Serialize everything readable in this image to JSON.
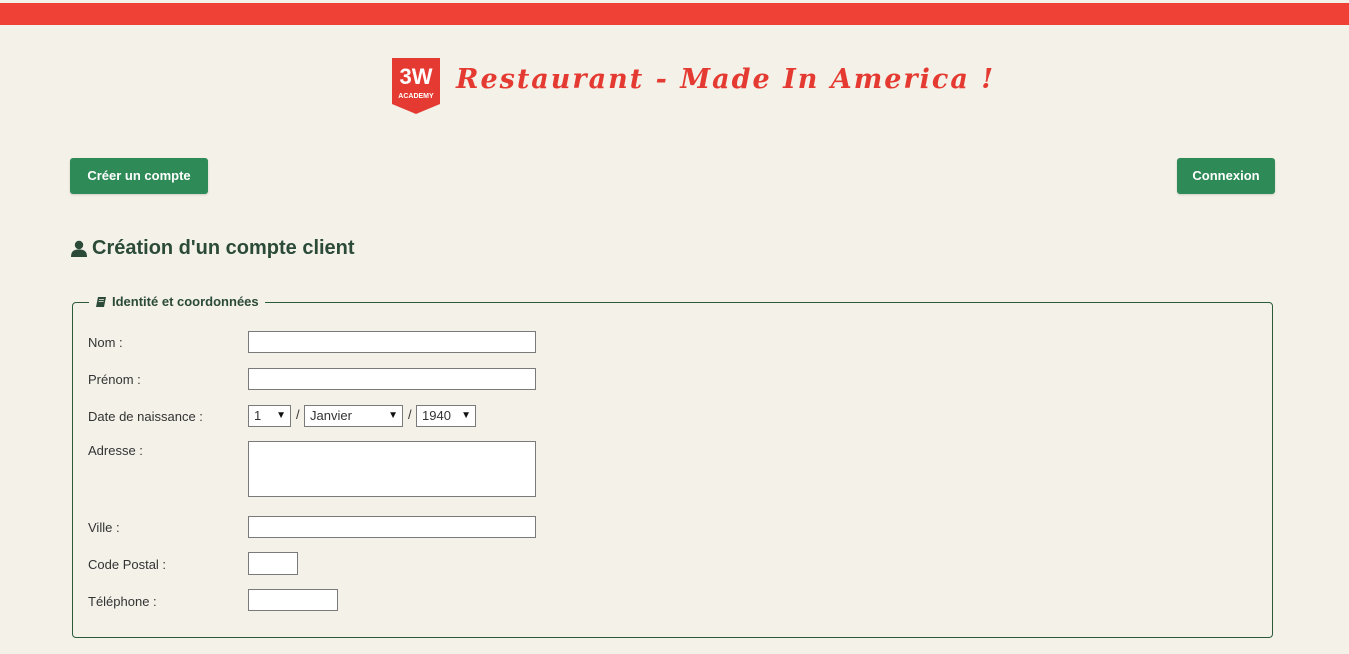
{
  "header": {
    "logo_text": "3W",
    "logo_subtext": "ACADEMY",
    "title": "Restaurant - Made In America !"
  },
  "nav": {
    "register_label": "Créer un compte",
    "login_label": "Connexion"
  },
  "page": {
    "title": "Création d'un compte client",
    "title_icon": "user-icon"
  },
  "form": {
    "legend": "Identité et coordonnées",
    "legend_icon": "book-icon",
    "fields": {
      "nom_label": "Nom :",
      "nom_value": "",
      "prenom_label": "Prénom :",
      "prenom_value": "",
      "birth_label": "Date de naissance :",
      "birth_day": "1",
      "birth_month": "Janvier",
      "birth_year": "1940",
      "separator": "/",
      "adresse_label": "Adresse :",
      "adresse_value": "",
      "ville_label": "Ville :",
      "ville_value": "",
      "cp_label": "Code Postal :",
      "cp_value": "",
      "tel_label": "Téléphone :",
      "tel_value": ""
    }
  },
  "colors": {
    "accent_red": "#ef4136",
    "button_green": "#2e8b57",
    "dark_green": "#2b4a37",
    "background": "#f3f1e8"
  }
}
